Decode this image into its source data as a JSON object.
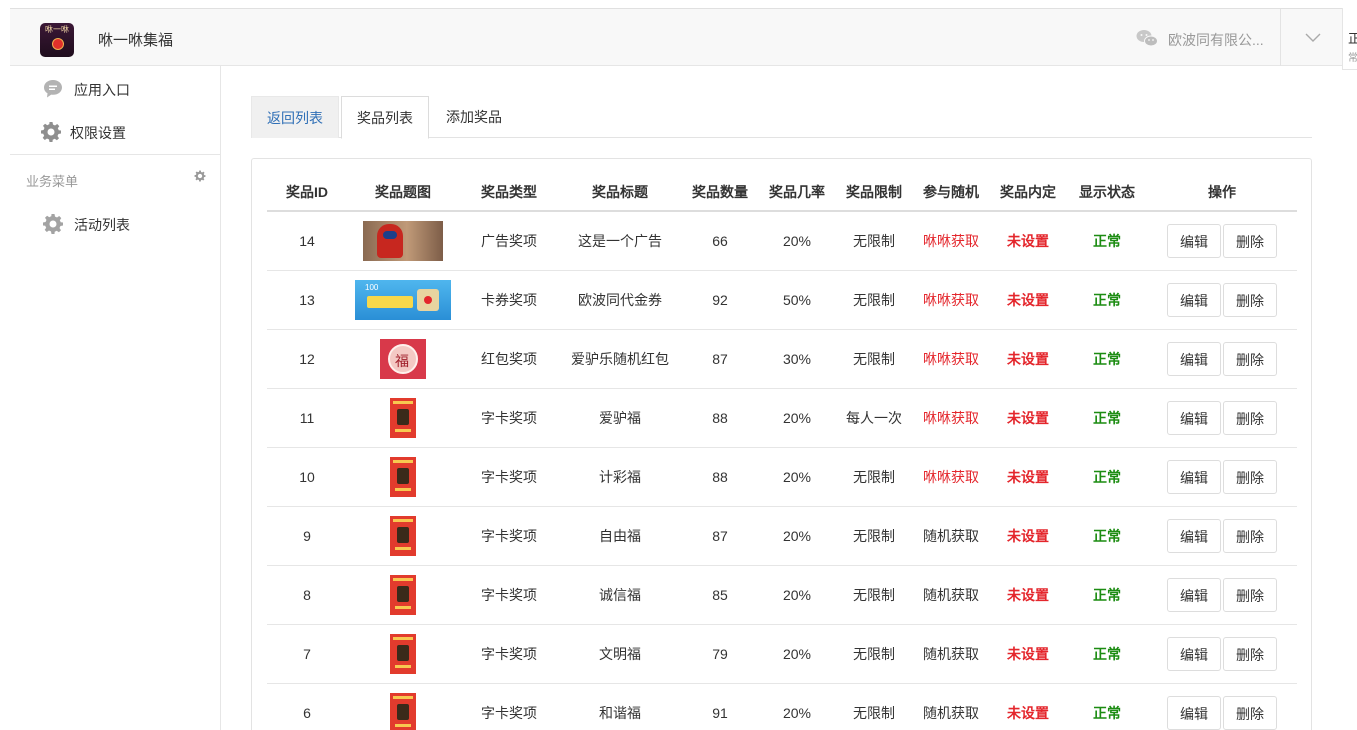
{
  "header": {
    "app_title": "咻一咻集福",
    "logo_text": "咻一咻",
    "account_name": "欧波同有限公...",
    "right_strip_line1": "正",
    "right_strip_line2": "常"
  },
  "sidebar": {
    "items": [
      {
        "label": "应用入口",
        "icon": "chat-bubble-icon"
      },
      {
        "label": "权限设置",
        "icon": "gear-icon"
      }
    ],
    "section_title": "业务菜单",
    "section_items": [
      {
        "label": "活动列表",
        "icon": "gear-icon"
      }
    ]
  },
  "tabs": {
    "back": "返回列表",
    "list": "奖品列表",
    "add": "添加奖品"
  },
  "table": {
    "headers": [
      "奖品ID",
      "奖品题图",
      "奖品类型",
      "奖品标题",
      "奖品数量",
      "奖品几率",
      "奖品限制",
      "参与随机",
      "奖品内定",
      "显示状态",
      "操作"
    ],
    "edit_label": "编辑",
    "delete_label": "删除",
    "rows": [
      {
        "id": "14",
        "type": "广告奖项",
        "title": "这是一个广告",
        "qty": "66",
        "rate": "20%",
        "limit": "无限制",
        "random": "咻咻获取",
        "random_red": true,
        "preset": "未设置",
        "status": "正常",
        "thumb": "ad"
      },
      {
        "id": "13",
        "type": "卡券奖项",
        "title": "欧波同代金券",
        "qty": "92",
        "rate": "50%",
        "limit": "无限制",
        "random": "咻咻获取",
        "random_red": true,
        "preset": "未设置",
        "status": "正常",
        "thumb": "coupon"
      },
      {
        "id": "12",
        "type": "红包奖项",
        "title": "爱驴乐随机红包",
        "qty": "87",
        "rate": "30%",
        "limit": "无限制",
        "random": "咻咻获取",
        "random_red": true,
        "preset": "未设置",
        "status": "正常",
        "thumb": "redpack"
      },
      {
        "id": "11",
        "type": "字卡奖项",
        "title": "爱驴福",
        "qty": "88",
        "rate": "20%",
        "limit": "每人一次",
        "random": "咻咻获取",
        "random_red": true,
        "preset": "未设置",
        "status": "正常",
        "thumb": "card"
      },
      {
        "id": "10",
        "type": "字卡奖项",
        "title": "计彩福",
        "qty": "88",
        "rate": "20%",
        "limit": "无限制",
        "random": "咻咻获取",
        "random_red": true,
        "preset": "未设置",
        "status": "正常",
        "thumb": "card"
      },
      {
        "id": "9",
        "type": "字卡奖项",
        "title": "自由福",
        "qty": "87",
        "rate": "20%",
        "limit": "无限制",
        "random": "随机获取",
        "random_red": false,
        "preset": "未设置",
        "status": "正常",
        "thumb": "card"
      },
      {
        "id": "8",
        "type": "字卡奖项",
        "title": "诚信福",
        "qty": "85",
        "rate": "20%",
        "limit": "无限制",
        "random": "随机获取",
        "random_red": false,
        "preset": "未设置",
        "status": "正常",
        "thumb": "card"
      },
      {
        "id": "7",
        "type": "字卡奖项",
        "title": "文明福",
        "qty": "79",
        "rate": "20%",
        "limit": "无限制",
        "random": "随机获取",
        "random_red": false,
        "preset": "未设置",
        "status": "正常",
        "thumb": "card"
      },
      {
        "id": "6",
        "type": "字卡奖项",
        "title": "和谐福",
        "qty": "91",
        "rate": "20%",
        "limit": "无限制",
        "random": "随机获取",
        "random_red": false,
        "preset": "未设置",
        "status": "正常",
        "thumb": "card"
      }
    ]
  },
  "colors": {
    "red": "#e4262c",
    "green": "#1c8c12",
    "link_blue": "#2f6fb6"
  }
}
